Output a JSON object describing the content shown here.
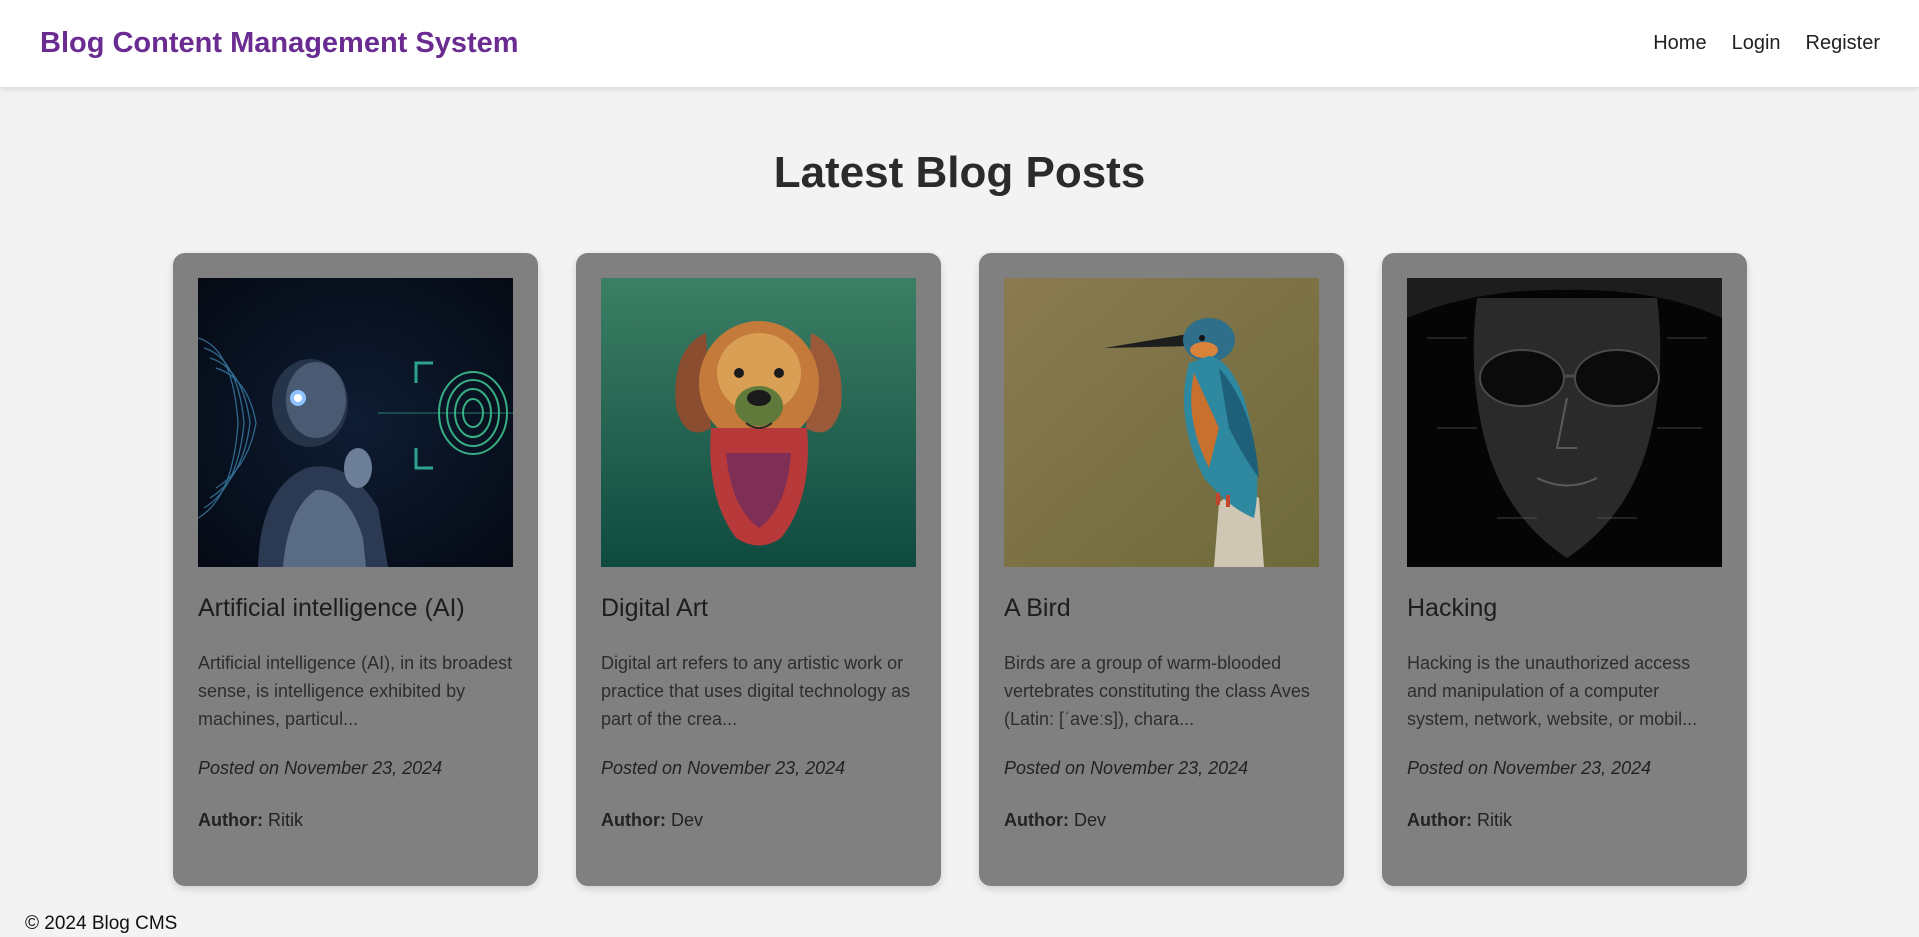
{
  "header": {
    "brand": "Blog Content Management System",
    "nav": [
      "Home",
      "Login",
      "Register"
    ]
  },
  "main": {
    "heading": "Latest Blog Posts",
    "posts": [
      {
        "title": "Artificial intelligence (AI)",
        "excerpt": "Artificial intelligence (AI), in its broadest sense, is intelligence exhibited by machines, particul...",
        "date": "Posted on November 23, 2024",
        "author_label": "Author:",
        "author": "Ritik",
        "image": "ai-robot-fingerprint-image"
      },
      {
        "title": "Digital Art",
        "excerpt": "Digital art refers to any artistic work or practice that uses digital technology as part of the crea...",
        "date": "Posted on November 23, 2024",
        "author_label": "Author:",
        "author": "Dev",
        "image": "colorful-dog-portrait-image"
      },
      {
        "title": "A Bird",
        "excerpt": "Birds are a group of warm-blooded vertebrates constituting the class Aves (Latin: [ˈaveːs]), chara...",
        "date": "Posted on November 23, 2024",
        "author_label": "Author:",
        "author": "Dev",
        "image": "kingfisher-bird-image"
      },
      {
        "title": "Hacking",
        "excerpt": "Hacking is the unauthorized access and manipulation of a computer system, network, website, or mobil...",
        "date": "Posted on November 23, 2024",
        "author_label": "Author:",
        "author": "Ritik",
        "image": "hacker-text-face-image"
      }
    ]
  },
  "footer": {
    "text": "© 2024 Blog CMS"
  },
  "colors": {
    "brand": "#6a2c91",
    "card_bg": "#808080",
    "page_bg": "#f3f3f3"
  }
}
